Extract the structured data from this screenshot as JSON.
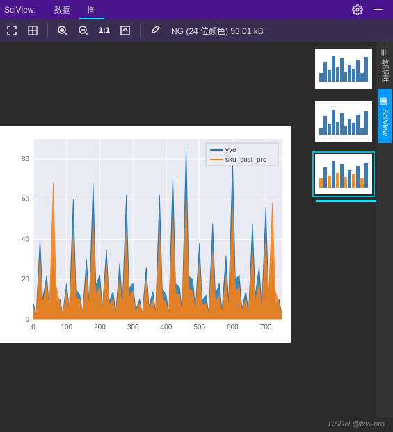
{
  "titlebar": {
    "title": "SciView:",
    "tabs": [
      {
        "label": "数据",
        "active": false
      },
      {
        "label": "图",
        "active": true
      }
    ]
  },
  "toolbar": {
    "status": "NG (24 位颜色) 53.01 kB",
    "one_to_one": "1:1"
  },
  "right_rail": {
    "items": [
      {
        "label": "数据库",
        "active": false
      },
      {
        "label": "SciView",
        "active": true
      }
    ]
  },
  "thumbnails": [
    {
      "id": 0,
      "kind": "blue",
      "selected": false
    },
    {
      "id": 1,
      "kind": "blue",
      "selected": false
    },
    {
      "id": 2,
      "kind": "mixed",
      "selected": true
    }
  ],
  "footer": {
    "watermark": "CSDN @lxw-pro"
  },
  "chart_data": {
    "type": "line",
    "title": "",
    "xlabel": "",
    "ylabel": "",
    "xlim": [
      0,
      750
    ],
    "ylim": [
      0,
      90
    ],
    "xticks": [
      0,
      100,
      200,
      300,
      400,
      500,
      600,
      700
    ],
    "yticks": [
      0,
      20,
      40,
      60,
      80
    ],
    "legend": {
      "position": "upper-right",
      "entries": [
        "yye",
        "sku_cost_prc"
      ]
    },
    "series": [
      {
        "name": "yye",
        "color": "#1f77b4",
        "x": [
          0,
          20,
          40,
          60,
          80,
          100,
          120,
          140,
          160,
          180,
          200,
          220,
          240,
          260,
          280,
          300,
          320,
          340,
          360,
          380,
          400,
          420,
          440,
          460,
          480,
          500,
          520,
          540,
          560,
          580,
          600,
          620,
          640,
          660,
          680,
          700,
          720,
          740
        ],
        "y": [
          8,
          40,
          22,
          32,
          10,
          18,
          60,
          12,
          30,
          68,
          22,
          35,
          14,
          28,
          62,
          18,
          10,
          26,
          14,
          62,
          12,
          72,
          16,
          86,
          20,
          38,
          12,
          48,
          18,
          32,
          80,
          22,
          14,
          48,
          26,
          56,
          30,
          10
        ]
      },
      {
        "name": "sku_cost_prc",
        "color": "#ff7f0e",
        "x": [
          0,
          20,
          40,
          60,
          80,
          100,
          120,
          140,
          160,
          180,
          200,
          220,
          240,
          260,
          280,
          300,
          320,
          340,
          360,
          380,
          400,
          420,
          440,
          460,
          480,
          500,
          520,
          540,
          560,
          580,
          600,
          620,
          640,
          660,
          680,
          700,
          720,
          740
        ],
        "y": [
          6,
          30,
          18,
          68,
          8,
          14,
          42,
          10,
          22,
          48,
          16,
          28,
          10,
          20,
          44,
          14,
          8,
          20,
          10,
          44,
          8,
          52,
          12,
          60,
          14,
          28,
          8,
          34,
          12,
          22,
          56,
          16,
          10,
          34,
          18,
          40,
          58,
          8
        ]
      }
    ]
  }
}
